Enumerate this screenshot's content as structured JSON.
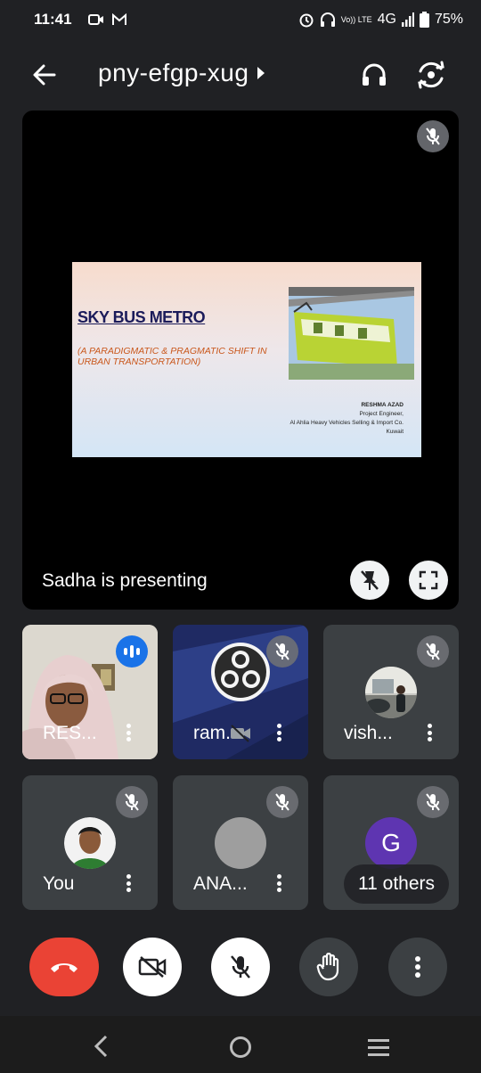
{
  "status": {
    "time": "11:41",
    "volte": "Vo)) LTE",
    "network": "4G",
    "battery": "75%"
  },
  "header": {
    "meeting_code": "pny-efgp-xug"
  },
  "stage": {
    "presenting_text": "Sadha is presenting",
    "slide": {
      "title": "SKY BUS METRO",
      "subtitle": "(A PARADIGMATIC & PRAGMATIC SHIFT IN URBAN TRANSPORTATION)",
      "author_name": "RESHMA AZAD",
      "author_role": "Project Engineer,",
      "author_company": "Al Ahlia Heavy Vehicles Selling & Import Co.",
      "author_country": "Kuwait"
    }
  },
  "tiles": [
    {
      "name": "RES...",
      "state": "speaking"
    },
    {
      "name": "ram...",
      "state": "muted"
    },
    {
      "name": "vish...",
      "state": "muted"
    },
    {
      "name": "You",
      "state": "muted"
    },
    {
      "name": "ANA...",
      "state": "muted"
    },
    {
      "name": "G",
      "state": "muted",
      "overflow_label": "11 others",
      "avatar_color": "#5e35b1"
    }
  ],
  "colors": {
    "background": "#202124",
    "end_call": "#ea4335",
    "tile": "#3c4043",
    "speaking": "#1a73e8"
  },
  "icons": [
    "back-arrow-icon",
    "headphones-icon",
    "switch-camera-icon",
    "mic-off-icon",
    "unpin-icon",
    "fullscreen-icon",
    "camera-off-icon",
    "raise-hand-icon",
    "more-vert-icon",
    "end-call-icon"
  ]
}
